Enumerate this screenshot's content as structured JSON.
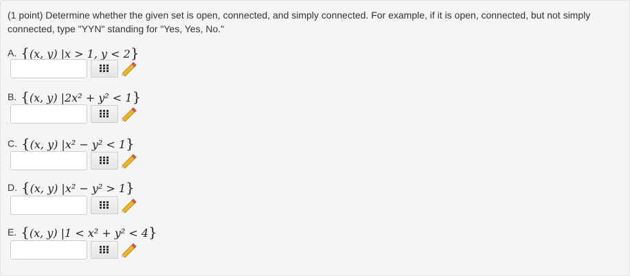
{
  "prompt": "(1 point) Determine whether the given set is open, connected, and simply connected. For example, if it is open, connected, but not simply connected, type \"YYN\" standing for \"Yes, Yes, No.\"",
  "parts": [
    {
      "letter": "A.",
      "expr_open": "{",
      "expr_body": "(x, y) |x > 1, y < 2",
      "expr_close": "}",
      "value": ""
    },
    {
      "letter": "B.",
      "expr_open": "{",
      "expr_body": "(x, y) |2x² + y² < 1",
      "expr_close": "}",
      "value": ""
    },
    {
      "letter": "C.",
      "expr_open": "{",
      "expr_body": "(x, y) |x² − y² < 1",
      "expr_close": "}",
      "value": ""
    },
    {
      "letter": "D.",
      "expr_open": "{",
      "expr_body": "(x, y) |x² − y² > 1",
      "expr_close": "}",
      "value": ""
    },
    {
      "letter": "E.",
      "expr_open": "{",
      "expr_body": "(x, y) |1 < x² + y² < 4",
      "expr_close": "}",
      "value": ""
    }
  ],
  "icons": {
    "palette": "grid-palette-icon",
    "edit": "pencil-icon"
  }
}
